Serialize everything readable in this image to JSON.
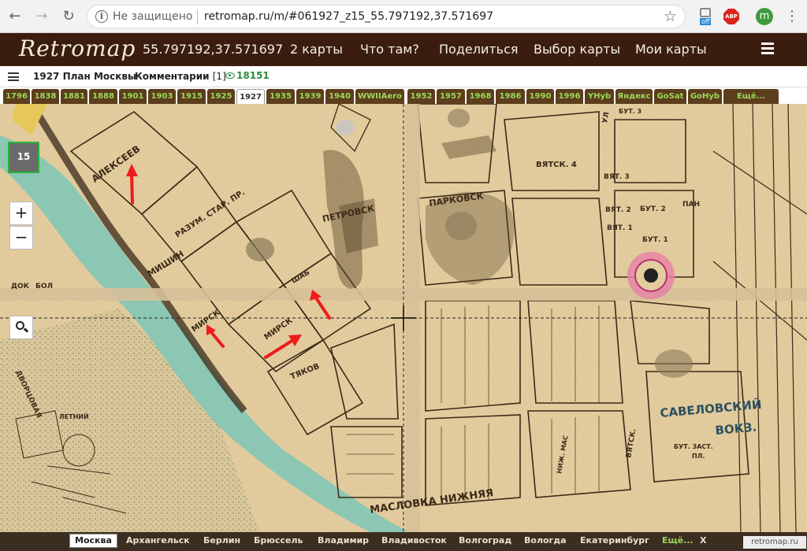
{
  "browser": {
    "security": "Не защищено",
    "url": "retromap.ru/m/#061927_z15_55.797192,37.571697",
    "ext_badge": "off",
    "adblock": "ABP",
    "profile_initial": "m"
  },
  "header": {
    "logo": "Retromap",
    "coords": "55.797192,37.571697",
    "nav": [
      "2 карты",
      "Что там?",
      "Поделиться",
      "Выбор карты",
      "Мои карты"
    ]
  },
  "infobar": {
    "map_title": "1927 План Москвы",
    "comments_label": "Комментарии",
    "comments_count": "[1]",
    "views": "18151"
  },
  "year_tabs": [
    "1796",
    "1838",
    "1881",
    "1888",
    "1901",
    "1903",
    "1915",
    "1925",
    "1927",
    "1935",
    "1939",
    "1940",
    "WWIIAero",
    "1952",
    "1957",
    "1968",
    "1986",
    "1990",
    "1996",
    "YHyb",
    "Яндекс",
    "GoSat",
    "GoHyb",
    "Ещё..."
  ],
  "active_tab": "1927",
  "map": {
    "zoom_level": "15",
    "zoom_in": "+",
    "zoom_out": "−",
    "labels": {
      "alekseev": "АЛЕКСЕЕВ",
      "razum": "РАЗУМ. СТАР. ПР.",
      "mishin": "МИШИН",
      "petrovsk": "ПЕТРОВСК",
      "parkovsk": "ПАРКОВСК",
      "vyatsk4": "ВЯТСК. 4",
      "vyat3": "ВЯТ. 3",
      "vyat2": "ВЯТ. 2",
      "vyat1": "ВЯТ. 1",
      "but3": "БУТ. 3",
      "but2": "БУТ. 2",
      "but1": "БУТ. 1",
      "pan": "ПАН",
      "mirsk": "МИРСК",
      "shabol": "ШАБ",
      "tyakov": "ТЯКОВ",
      "dok": "ДОК",
      "bol": "БОЛ",
      "dvortsovaya": "ДВОРЦОВАЯ",
      "letnii": "ЛЕТНИЙ",
      "savelovsky": "САВЕЛОВСКИЙ",
      "vokz": "ВОКЗ.",
      "maslovka": "МАСЛОВКА НИЖНЯЯ",
      "nizh_mas": "НИЖ. МАС",
      "vyatsk": "ВЯТСК.",
      "but_zast": "БУТ. ЗАСТ.",
      "pl": "ПЛ.",
      "ul": "УЛ"
    }
  },
  "cities": [
    "Москва",
    "Архангельск",
    "Берлин",
    "Брюссель",
    "Владимир",
    "Владивосток",
    "Волгоград",
    "Вологда",
    "Екатеринбург",
    "Ещё..."
  ],
  "city_close": "X",
  "watermark": "retromap.ru",
  "colors": {
    "header_bg": "#3b1d10",
    "tab_bg": "#5c3d1c",
    "tab_text": "#9bd85a",
    "map_paper": "#e3cc9e",
    "river": "#8cc7b4"
  }
}
